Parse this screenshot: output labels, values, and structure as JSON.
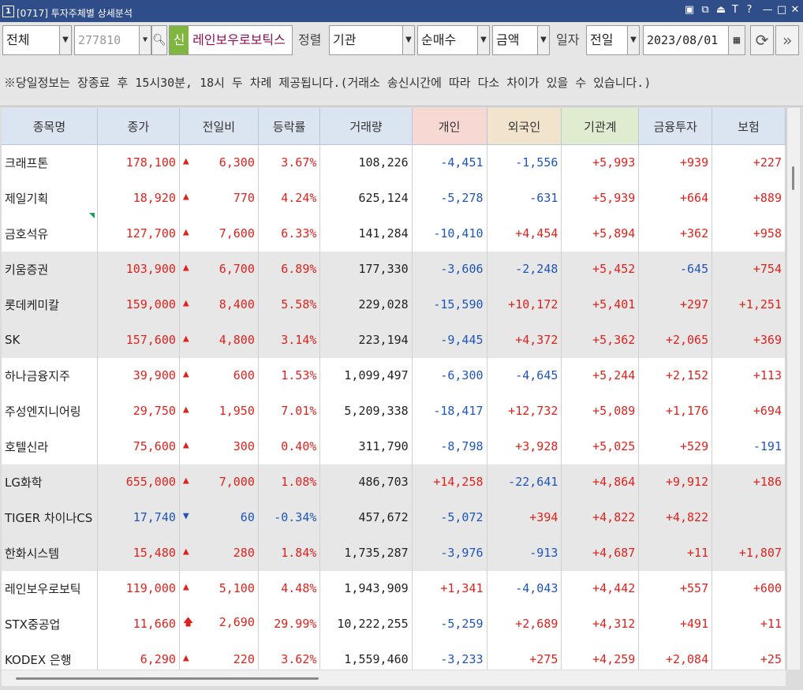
{
  "window": {
    "icon_label": "1",
    "title": "[0717] 투자주체별 상세분석"
  },
  "titlebar_buttons": [
    "▣",
    "⧉",
    "⏏",
    "T",
    "?",
    "—",
    "□",
    "✕"
  ],
  "toolbar": {
    "market": "전체",
    "code": "277810",
    "new_badge": "신",
    "stock_name": "레인보우로보틱스",
    "sort_label": "정렬",
    "sort_by": "기관",
    "measure": "순매수",
    "unit": "금액",
    "date_label": "일자",
    "day": "전일",
    "date": "2023/08/01",
    "refresh_icon": "refresh-icon",
    "next_icon": "double-chevron-right-icon"
  },
  "notice": "※당일정보는 장종료 후 15시30분, 18시 두 차례 제공됩니다.(거래소 송신시간에 따라 다소 차이가 있을 수 있습니다.)",
  "table": {
    "headers": [
      "종목명",
      "종가",
      "전일비",
      "등락률",
      "거래량",
      "개인",
      "외국인",
      "기관계",
      "금융투자",
      "보험"
    ],
    "rows": [
      {
        "name": "크래프톤",
        "close": "178,100",
        "dir": "up",
        "change": "6,300",
        "rate": "3.67%",
        "volume": "108,226",
        "indiv": "-4,451",
        "foreign": "-1,556",
        "inst": "+5,993",
        "fin": "+939",
        "ins": "+227"
      },
      {
        "name": "제일기획",
        "close": "18,920",
        "dir": "up",
        "change": "770",
        "rate": "4.24%",
        "volume": "625,124",
        "indiv": "-5,278",
        "foreign": "-631",
        "inst": "+5,939",
        "fin": "+664",
        "ins": "+889"
      },
      {
        "name": "금호석유",
        "close": "127,700",
        "dir": "up",
        "change": "7,600",
        "rate": "6.33%",
        "volume": "141,284",
        "indiv": "-10,410",
        "foreign": "+4,454",
        "inst": "+5,894",
        "fin": "+362",
        "ins": "+958"
      },
      {
        "name": "키움증권",
        "close": "103,900",
        "dir": "up",
        "change": "6,700",
        "rate": "6.89%",
        "volume": "177,330",
        "indiv": "-3,606",
        "foreign": "-2,248",
        "inst": "+5,452",
        "fin": "-645",
        "ins": "+754"
      },
      {
        "name": "롯데케미칼",
        "close": "159,000",
        "dir": "up",
        "change": "8,400",
        "rate": "5.58%",
        "volume": "229,028",
        "indiv": "-15,590",
        "foreign": "+10,172",
        "inst": "+5,401",
        "fin": "+297",
        "ins": "+1,251"
      },
      {
        "name": "SK",
        "close": "157,600",
        "dir": "up",
        "change": "4,800",
        "rate": "3.14%",
        "volume": "223,194",
        "indiv": "-9,445",
        "foreign": "+4,372",
        "inst": "+5,362",
        "fin": "+2,065",
        "ins": "+369"
      },
      {
        "name": "하나금융지주",
        "close": "39,900",
        "dir": "up",
        "change": "600",
        "rate": "1.53%",
        "volume": "1,099,497",
        "indiv": "-6,300",
        "foreign": "-4,645",
        "inst": "+5,244",
        "fin": "+2,152",
        "ins": "+113"
      },
      {
        "name": "주성엔지니어링",
        "close": "29,750",
        "dir": "up",
        "change": "1,950",
        "rate": "7.01%",
        "volume": "5,209,338",
        "indiv": "-18,417",
        "foreign": "+12,732",
        "inst": "+5,089",
        "fin": "+1,176",
        "ins": "+694"
      },
      {
        "name": "호텔신라",
        "close": "75,600",
        "dir": "up",
        "change": "300",
        "rate": "0.40%",
        "volume": "311,790",
        "indiv": "-8,798",
        "foreign": "+3,928",
        "inst": "+5,025",
        "fin": "+529",
        "ins": "-191"
      },
      {
        "name": "LG화학",
        "close": "655,000",
        "dir": "up",
        "change": "7,000",
        "rate": "1.08%",
        "volume": "486,703",
        "indiv": "+14,258",
        "foreign": "-22,641",
        "inst": "+4,864",
        "fin": "+9,912",
        "ins": "+186"
      },
      {
        "name": "TIGER 차이나CS",
        "close": "17,740",
        "dir": "down",
        "change": "60",
        "rate": "-0.34%",
        "volume": "457,672",
        "indiv": "-5,072",
        "foreign": "+394",
        "inst": "+4,822",
        "fin": "+4,822",
        "ins": ""
      },
      {
        "name": "한화시스템",
        "close": "15,480",
        "dir": "up",
        "change": "280",
        "rate": "1.84%",
        "volume": "1,735,287",
        "indiv": "-3,976",
        "foreign": "-913",
        "inst": "+4,687",
        "fin": "+11",
        "ins": "+1,807"
      },
      {
        "name": "레인보우로보틱",
        "close": "119,000",
        "dir": "up",
        "change": "5,100",
        "rate": "4.48%",
        "volume": "1,943,909",
        "indiv": "+1,341",
        "foreign": "-4,043",
        "inst": "+4,442",
        "fin": "+557",
        "ins": "+600"
      },
      {
        "name": "STX중공업",
        "close": "11,660",
        "dir": "limit",
        "change": "2,690",
        "rate": "29.99%",
        "volume": "10,222,255",
        "indiv": "-5,259",
        "foreign": "+2,689",
        "inst": "+4,312",
        "fin": "+491",
        "ins": "+11"
      },
      {
        "name": "KODEX 은행",
        "close": "6,290",
        "dir": "up",
        "change": "220",
        "rate": "3.62%",
        "volume": "1,559,460",
        "indiv": "-3,233",
        "foreign": "+275",
        "inst": "+4,259",
        "fin": "+2,084",
        "ins": "+25"
      }
    ]
  },
  "colors": {
    "up": "#e0221d",
    "down": "#1f55b8",
    "titlebar": "#2f4d88"
  }
}
